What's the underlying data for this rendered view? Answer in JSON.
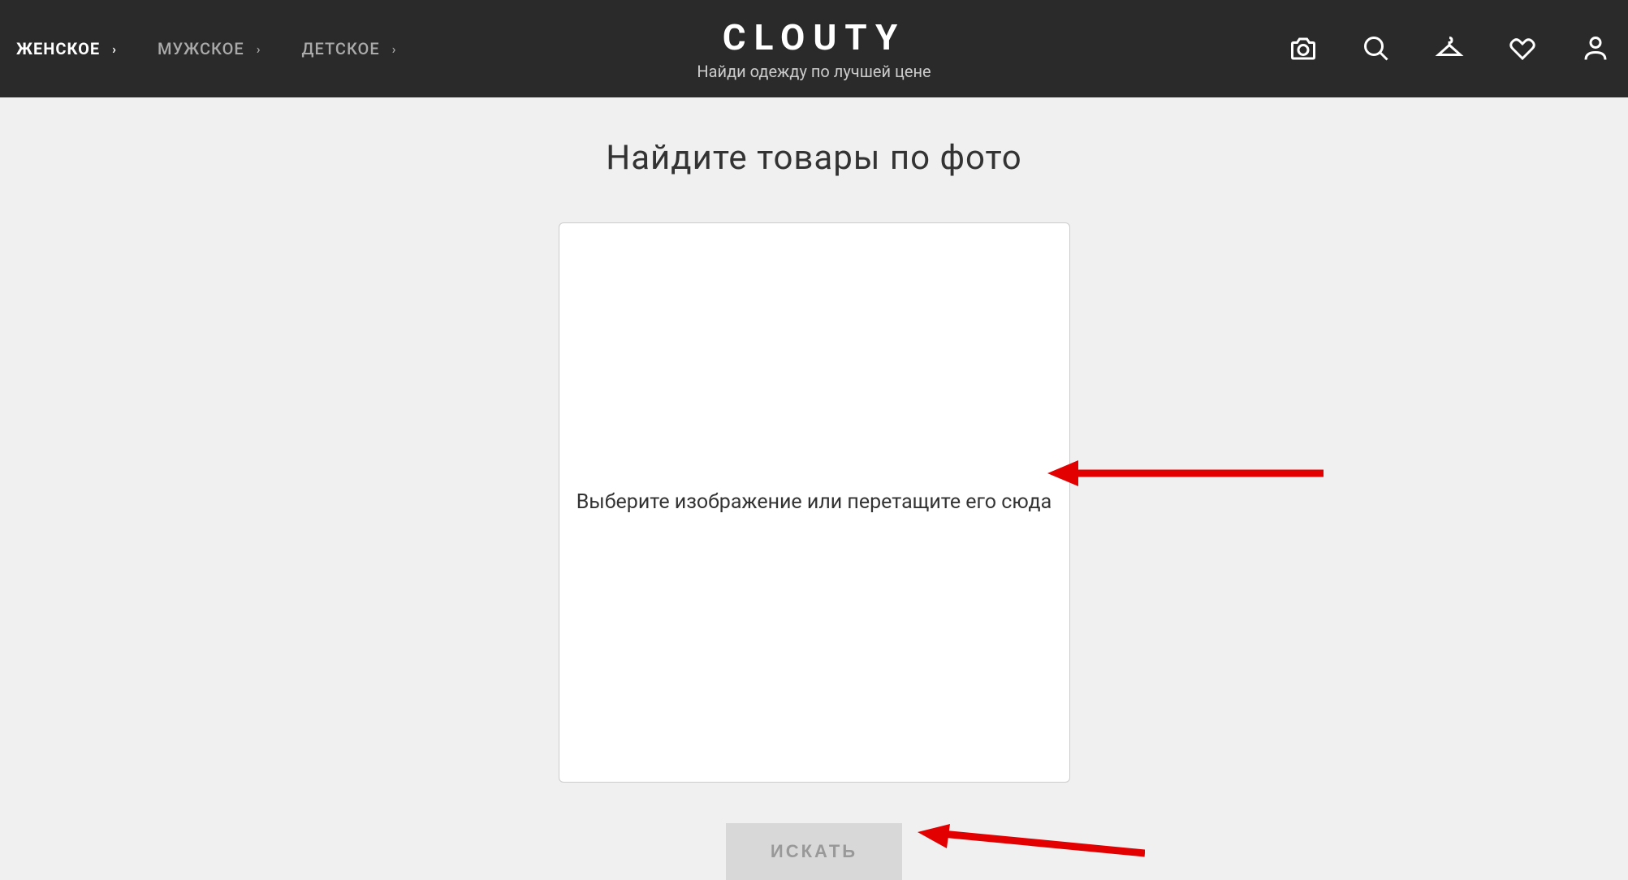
{
  "header": {
    "logo": "CLOUTY",
    "tagline": "Найди одежду по лучшей цене",
    "nav": [
      {
        "label": "ЖЕНСКОЕ",
        "active": true
      },
      {
        "label": "МУЖСКОЕ",
        "active": false
      },
      {
        "label": "ДЕТСКОЕ",
        "active": false
      }
    ]
  },
  "main": {
    "title": "Найдите товары по фото",
    "dropzone_text": "Выберите изображение или перетащите его сюда",
    "search_button": "ИСКАТЬ"
  }
}
